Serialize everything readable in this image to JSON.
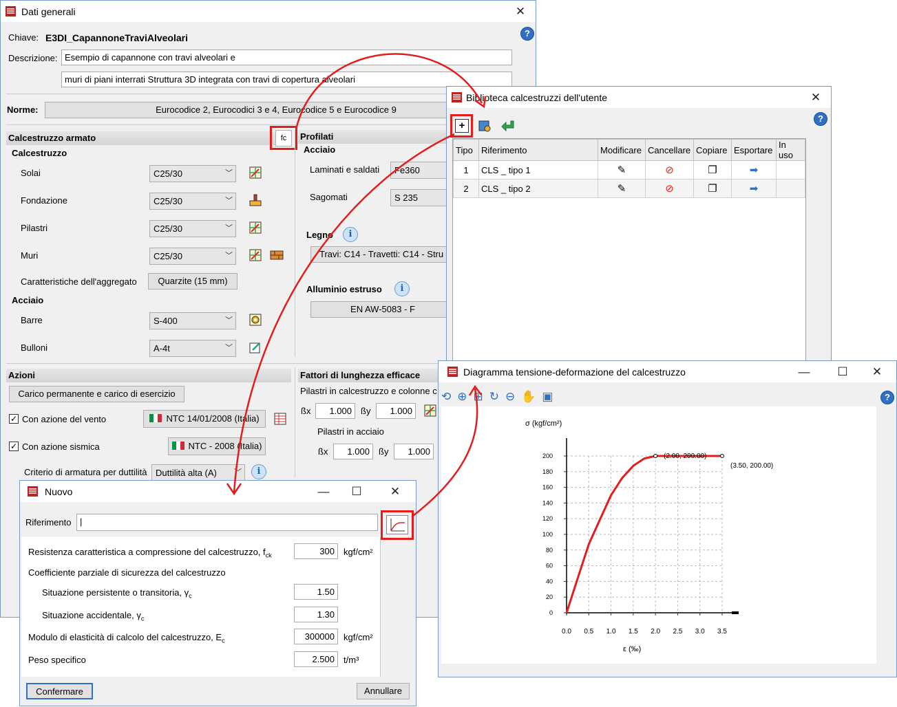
{
  "dati": {
    "title": "Dati generali",
    "chiave_label": "Chiave:",
    "chiave_value": "E3DI_CapannoneTraviAlveolari",
    "descrizione_label": "Descrizione:",
    "descrizione_1": "Esempio di capannone con travi alveolari e",
    "descrizione_2": "muri di piani interrati Struttura 3D integrata con travi di copertura alveolari",
    "norme_label": "Norme:",
    "norme_value": "Eurocodice 2, Eurocodici 3 e 4, Eurocodice 5 e Eurocodice 9",
    "ca_header": "Calcestruzzo armato",
    "fc_label": "fc",
    "calcestruzzo_label": "Calcestruzzo",
    "solai_label": "Solai",
    "solai_value": "C25/30",
    "fondazione_label": "Fondazione",
    "fondazione_value": "C25/30",
    "pilastri_label": "Pilastri",
    "pilastri_value": "C25/30",
    "muri_label": "Muri",
    "muri_value": "C25/30",
    "aggregato_label": "Caratteristiche dell'aggregato",
    "aggregato_button": "Quarzite (15 mm)",
    "acciaio_label": "Acciaio",
    "barre_label": "Barre",
    "barre_value": "S-400",
    "bulloni_label": "Bulloni",
    "bulloni_value": "A-4t",
    "profilati_header": "Profilati",
    "prof_acciaio_label": "Acciaio",
    "laminati_label": "Laminati e saldati",
    "laminati_value": "Fe360",
    "sagomati_label": "Sagomati",
    "sagomati_value": "S 235",
    "legno_label": "Legno",
    "legno_value": "Travi: C14 - Travetti: C14 - Stru",
    "alluminio_label": "Alluminio estruso",
    "alluminio_value": "EN AW-5083 - F",
    "azioni_header": "Azioni",
    "carico_button": "Carico permanente e carico di esercizio",
    "vento_label": "Con azione del vento",
    "vento_button": "NTC 14/01/2008 (Italia)",
    "sismica_label": "Con azione sismica",
    "sismica_button": "NTC - 2008 (Italia)",
    "duttilita_label": "Criterio di armatura per duttilità",
    "duttilita_value": "Duttilità alta (A)",
    "fattori_header": "Fattori di lunghezza efficace",
    "fattori_sub": "Pilastri in calcestruzzo e colonne c",
    "bx_label": "ßx",
    "by_label": "ßy",
    "bx1": "1.000",
    "by1": "1.000",
    "pilastri_acciaio_label": "Pilastri in acciaio",
    "bx2": "1.000",
    "by2": "1.000"
  },
  "biblioteca": {
    "title": "Biblioteca calcestruzzi dell'utente",
    "columns": [
      "Tipo",
      "Riferimento",
      "Modificare",
      "Cancellare",
      "Copiare",
      "Esportare",
      "In uso"
    ],
    "rows": [
      {
        "tipo": "1",
        "riferimento": "CLS _ tipo 1"
      },
      {
        "tipo": "2",
        "riferimento": "CLS _ tipo 2"
      }
    ]
  },
  "diagramma": {
    "title": "Diagramma tensione-deformazione del calcestruzzo"
  },
  "chart_data": {
    "type": "line",
    "ylabel": "σ (kgf/cm²)",
    "xlabel": "ε (‰)",
    "xlim": [
      0,
      3.5
    ],
    "ylim": [
      0,
      200
    ],
    "x_ticks": [
      "0.0",
      "0.5",
      "1.0",
      "1.5",
      "2.0",
      "2.5",
      "3.0",
      "3.5"
    ],
    "y_ticks": [
      "0",
      "20",
      "40",
      "60",
      "80",
      "100",
      "120",
      "140",
      "160",
      "180",
      "200"
    ],
    "grid": true,
    "series": [
      {
        "x": [
          0,
          0.25,
          0.5,
          0.75,
          1.0,
          1.25,
          1.5,
          1.75,
          2.0,
          3.5
        ],
        "y": [
          0,
          43.75,
          87.5,
          118.75,
          150,
          171.88,
          187.5,
          196.88,
          200,
          200
        ]
      }
    ],
    "annotations": [
      {
        "text": "(2.00, 200.00)",
        "x": 2.0,
        "y": 200
      },
      {
        "text": "(3.50, 200.00)",
        "x": 3.5,
        "y": 200
      }
    ]
  },
  "nuovo": {
    "title": "Nuovo",
    "riferimento_label": "Riferimento",
    "riferimento_value": "",
    "fck_label": "Resistenza caratteristica a compressione del calcestruzzo, f",
    "fck_sub": "ck",
    "fck_value": "300",
    "fck_unit": "kgf/cm²",
    "coeff_label": "Coefficiente parziale di sicurezza del calcestruzzo",
    "pers_label": "Situazione persistente o transitoria, γ",
    "pers_sub": "c",
    "pers_value": "1.50",
    "acc_label": "Situazione accidentale, γ",
    "acc_sub": "c",
    "acc_value": "1.30",
    "ec_label": "Modulo di elasticità di calcolo del calcestruzzo, E",
    "ec_sub": "c",
    "ec_value": "300000",
    "ec_unit": "kgf/cm²",
    "peso_label": "Peso specifico",
    "peso_value": "2.500",
    "peso_unit": "t/m³",
    "confermare": "Confermare",
    "annullare": "Annullare"
  },
  "colors": {
    "highlight": "#e11d1d",
    "curve": "#e11d1d",
    "title_bg": "#ffffff",
    "window_bg": "#f0f0f0"
  }
}
